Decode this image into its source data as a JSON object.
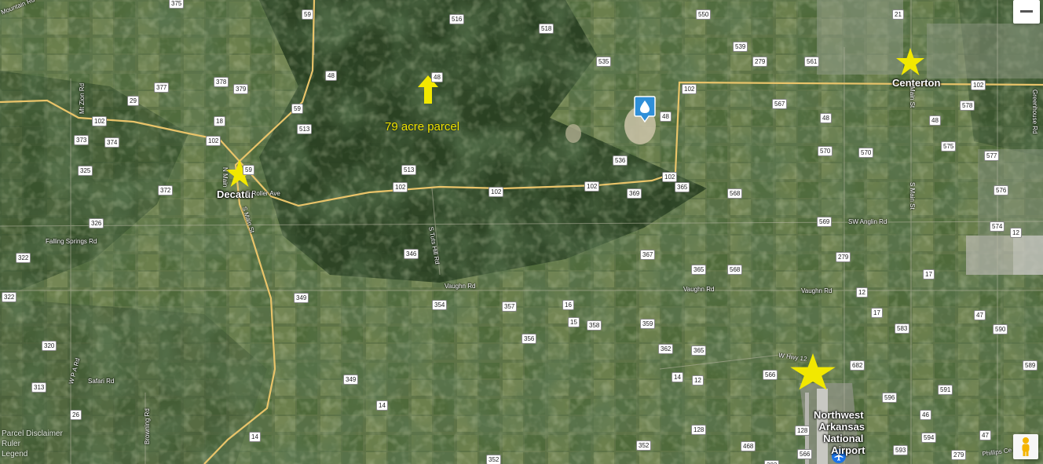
{
  "map": {
    "places": {
      "decatur": "Decatur",
      "centerton": "Centerton",
      "airport_line1": "Northwest",
      "airport_line2": "Arkansas",
      "airport_line3": "National",
      "airport_line4": "Airport"
    },
    "parcel_label": "79 acre parcel",
    "roads": {
      "mountain_rd": "Mountain Rd",
      "mt_zion_rd": "Mt Zion Rd",
      "n_main": "N Main",
      "e_roller_ave": "E Roller Ave",
      "s_main_st_decatur": "S Main St",
      "falling_springs_rd": "Falling Springs Rd",
      "s_tuts_hill_rd": "S Tuts Hill Rd",
      "vaughn_rd_1": "Vaughn Rd",
      "vaughn_rd_2": "Vaughn Rd",
      "vaughn_rd_3": "Vaughn Rd",
      "sw_anglin_rd": "SW Anglin Rd",
      "main_st_centerton": "Main St",
      "s_main_st_centerton": "S Main St",
      "greenhouse_rd": "Greenhouse Rd",
      "w_hwy_12": "W Hwy 12",
      "phillips_ce": "Phillips Ce",
      "safari_rd": "Safari Rd",
      "wpa_rd": "W P A Rd",
      "browning_rd": "Browning Rd"
    },
    "route_shields": [
      "375",
      "59",
      "516",
      "550",
      "21",
      "518",
      "539",
      "535",
      "279",
      "561",
      "48",
      "48",
      "377",
      "378",
      "379",
      "102",
      "102",
      "48",
      "578",
      "29",
      "59",
      "567",
      "48",
      "48",
      "102",
      "18",
      "513",
      "373",
      "374",
      "102",
      "570",
      "570",
      "575",
      "577",
      "325",
      "59",
      "536",
      "102",
      "365",
      "372",
      "513",
      "102",
      "102",
      "102",
      "369",
      "568",
      "576",
      "326",
      "574",
      "12",
      "569",
      "279",
      "322",
      "346",
      "367",
      "365",
      "568",
      "17",
      "322",
      "349",
      "354",
      "357",
      "16",
      "12",
      "17",
      "15",
      "358",
      "359",
      "47",
      "320",
      "356",
      "583",
      "590",
      "362",
      "365",
      "589",
      "313",
      "349",
      "14",
      "12",
      "566",
      "682",
      "591",
      "26",
      "14",
      "596",
      "46",
      "128",
      "128",
      "47",
      "594",
      "14",
      "352",
      "468",
      "566",
      "593",
      "279",
      "352",
      "382"
    ],
    "controls": {
      "zoom_out": "zoom-out",
      "pegman": "pegman-street-view"
    },
    "footer": {
      "parcel_disclaimer": "Parcel Disclaimer",
      "ruler": "Ruler",
      "legend": "Legend"
    },
    "icons": {
      "marker": "wells-water-drop-marker",
      "airport": "airplane-icon",
      "arrow": "up-arrow-icon",
      "stars": [
        "decatur-star-icon",
        "centerton-star-icon",
        "airport-star-icon"
      ]
    },
    "colors": {
      "star": "#f2e800",
      "arrow": "#f2e800",
      "highway": "#e9c46a",
      "marker": "#2f8fd8"
    }
  }
}
